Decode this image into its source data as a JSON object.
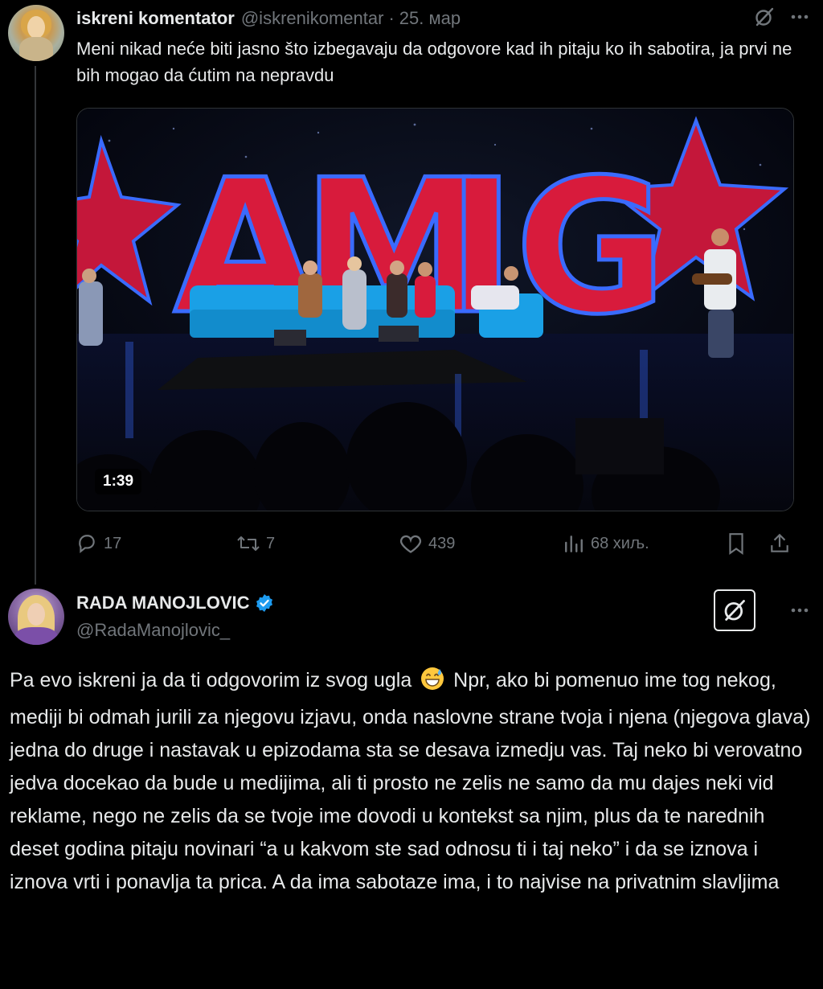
{
  "tweet1": {
    "name": "iskreni komentator",
    "handle": "@iskrenikomentar",
    "separator": "·",
    "date": "25. мар",
    "text": "Meni nikad neće biti jasno što izbegavaju da odgovore kad ih pitaju ko ih sabotira, ja prvi ne bih mogao da ćutim na nepravdu",
    "media": {
      "duration": "1:39",
      "sign_letters": [
        "A",
        "M",
        "I",
        "G"
      ]
    },
    "actions": {
      "replies": "17",
      "reposts": "7",
      "likes": "439",
      "views": "68 хиљ."
    }
  },
  "tweet2": {
    "name": "RADA MANOJLOVIC",
    "handle": "@RadaManojlovic_",
    "text_before_emoji": "Pa evo iskreni ja da ti odgovorim iz svog ugla",
    "emoji": "grinning-sweat-emoji",
    "text_after_emoji": "Npr, ako bi pomenuo ime tog nekog, mediji bi odmah jurili za njegovu izjavu, onda naslovne strane tvoja i njena (njegova glava) jedna do druge i nastavak u epizodama sta se desava izmedju vas. Taj neko bi verovatno jedva docekao da bude u medijima, ali ti prosto ne zelis ne samo da mu dajes neki vid reklame, nego ne zelis da se tvoje ime dovodi u kontekst sa njim, plus da te narednih deset godina pitaju novinari “a u kakvom ste sad odnosu ti i taj neko” i da se iznova i iznova vrti i ponavlja ta prica. A da ima sabotaze ima, i to najvise na privatnim slavljima"
  },
  "icons": {
    "grok": "grok-icon",
    "more": "more-icon",
    "reply": "reply-icon",
    "repost": "repost-icon",
    "like": "heart-icon",
    "views": "views-icon",
    "bookmark": "bookmark-icon",
    "share": "share-icon",
    "verified": "verified-badge-icon"
  },
  "colors": {
    "background": "#000000",
    "text": "#e7e9ea",
    "muted": "#71767b",
    "verified": "#1d9bf0",
    "sign_red": "#d81b3c",
    "neon_blue": "#3a6bff"
  }
}
